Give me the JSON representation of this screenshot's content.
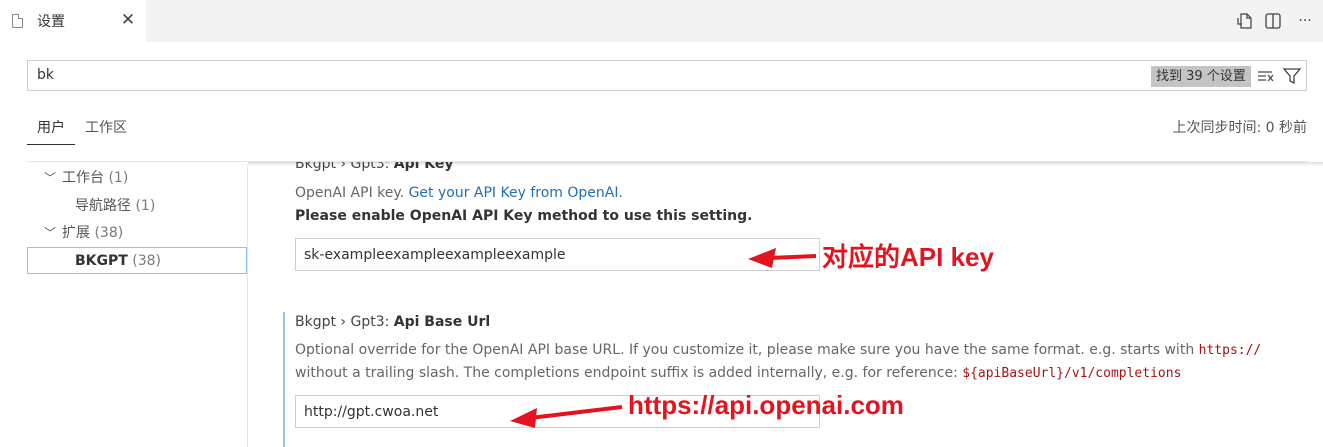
{
  "tab": {
    "title": "设置",
    "close": "✕"
  },
  "toolbar": {
    "more": "···"
  },
  "search": {
    "value": "bk",
    "result_count": "找到 39 个设置"
  },
  "scopes": {
    "user": "用户",
    "workspace": "工作区",
    "sync_status": "上次同步时间: 0 秒前"
  },
  "toc": [
    {
      "label": "工作台",
      "count": "(1)",
      "expanded": true
    },
    {
      "label": "导航路径",
      "count": "(1)"
    },
    {
      "label": "扩展",
      "count": "(38)",
      "expanded": true
    },
    {
      "label": "BKGPT",
      "count": "(38)",
      "selected": true
    }
  ],
  "settings": {
    "api_key": {
      "category": "Bkgpt › Gpt3: ",
      "name": "Api Key",
      "desc": "OpenAI API key. ",
      "link": "Get your API Key from OpenAI",
      "desc_end": ".",
      "warning": "Please enable OpenAI API Key method to use this setting.",
      "value": "sk-exampleexampleexampleexample"
    },
    "api_base_url": {
      "category": "Bkgpt › Gpt3: ",
      "name": "Api Base Url",
      "desc_1": "Optional override for the OpenAI API base URL. If you customize it, please make sure you have the same format. e.g. starts with ",
      "code_1": "https://",
      "desc_2": "without a trailing slash. The completions endpoint suffix is added internally, e.g. for reference: ",
      "code_2": "${apiBaseUrl}/v1/completions",
      "value": "http://gpt.cwoa.net"
    }
  },
  "annotations": {
    "api_key": "对应的API key",
    "base_url": "https://api.openai.com",
    "color": "#e3141f"
  },
  "colors": {
    "link": "#1f6fb5",
    "code": "#a31515",
    "focus": "#8fc7ec"
  }
}
